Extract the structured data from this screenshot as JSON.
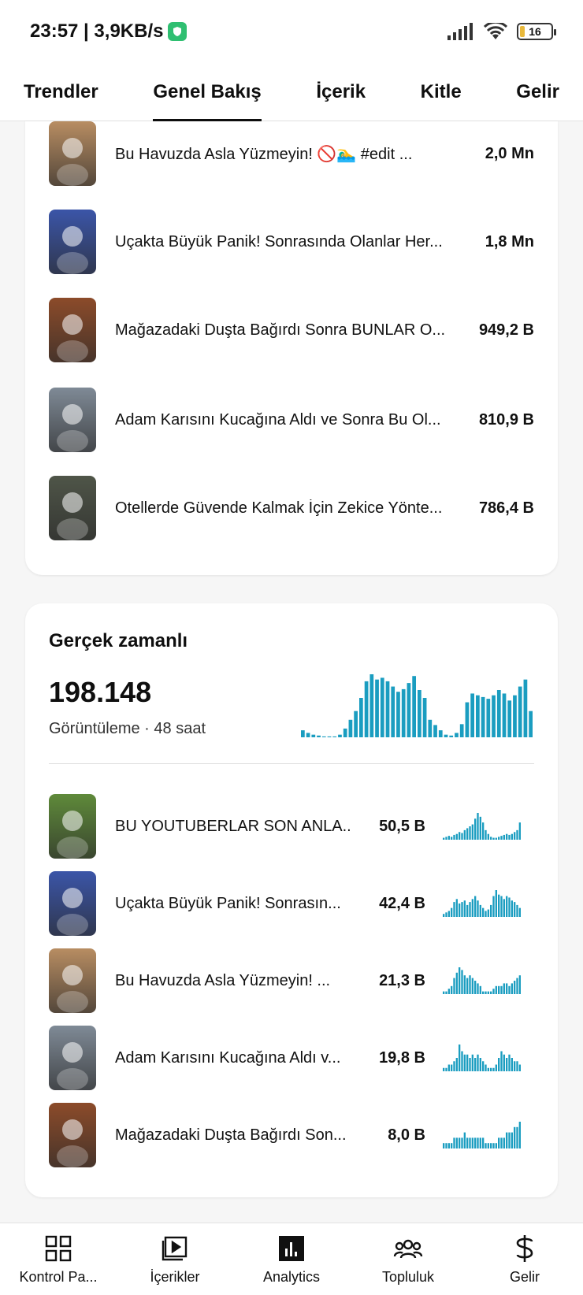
{
  "status_bar": {
    "time_speed": "23:57 | 3,9KB/s",
    "battery": "16"
  },
  "top_tabs": [
    {
      "label": "Trendler"
    },
    {
      "label": "Genel Bakış"
    },
    {
      "label": "İçerik"
    },
    {
      "label": "Kitle"
    },
    {
      "label": "Gelir"
    }
  ],
  "active_tab": "Genel Bakış",
  "top_list": {
    "items": [
      {
        "title": "Bu Havuzda Asla Yüzmeyin! 🚫🏊‍♂️ #edit ...",
        "value": "2,0 Mn",
        "thumb_color": "#b88d62"
      },
      {
        "title": "Uçakta Büyük Panik! Sonrasında Olanlar Her...",
        "value": "1,8 Mn",
        "thumb_color": "#3b55a8"
      },
      {
        "title": "Mağazadaki Duşta Bağırdı Sonra BUNLAR O...",
        "value": "949,2 B",
        "thumb_color": "#8c4b2a"
      },
      {
        "title": "Adam Karısını Kucağına Aldı ve Sonra Bu Ol...",
        "value": "810,9 B",
        "thumb_color": "#7f8a96"
      },
      {
        "title": "Otellerde Güvende Kalmak İçin Zekice Yönte...",
        "value": "786,4 B",
        "thumb_color": "#4f5548"
      }
    ]
  },
  "realtime": {
    "title": "Gerçek zamanlı",
    "total": "198.148",
    "subtitle": "Görüntüleme · 48 saat",
    "spark_color": "#1a9dc0",
    "spark": [
      8,
      5,
      3,
      2,
      1,
      1,
      1,
      3,
      10,
      20,
      30,
      45,
      64,
      72,
      66,
      68,
      64,
      58,
      52,
      55,
      62,
      70,
      54,
      45,
      20,
      14,
      8,
      3,
      2,
      5,
      15,
      40,
      50,
      48,
      46,
      44,
      48,
      54,
      50,
      42,
      48,
      58,
      66,
      30
    ],
    "items": [
      {
        "title": "BU YOUTUBERLAR SON ANLA...",
        "value": "50,5 B",
        "thumb_color": "#5f8a3a",
        "spark": [
          2,
          3,
          4,
          3,
          5,
          6,
          8,
          7,
          10,
          12,
          14,
          16,
          22,
          28,
          24,
          18,
          10,
          6,
          3,
          2,
          2,
          3,
          4,
          5,
          6,
          5,
          6,
          8,
          10,
          18
        ]
      },
      {
        "title": "Uçakta Büyük Panik! Sonrasın...",
        "value": "42,4 B",
        "thumb_color": "#3b55a8",
        "spark": [
          2,
          3,
          4,
          6,
          10,
          12,
          9,
          10,
          11,
          8,
          10,
          12,
          14,
          11,
          8,
          6,
          4,
          5,
          8,
          14,
          18,
          15,
          14,
          12,
          14,
          13,
          11,
          10,
          8,
          6
        ]
      },
      {
        "title": "Bu Havuzda Asla Yüzmeyin! ...",
        "value": "21,3 B",
        "thumb_color": "#b88d62",
        "spark": [
          1,
          1,
          2,
          3,
          6,
          8,
          10,
          9,
          7,
          6,
          7,
          6,
          5,
          4,
          3,
          1,
          1,
          1,
          1,
          2,
          3,
          3,
          3,
          4,
          4,
          3,
          4,
          5,
          6,
          7
        ]
      },
      {
        "title": "Adam Karısını Kucağına Aldı v...",
        "value": "19,8 B",
        "thumb_color": "#7f8a96",
        "spark": [
          1,
          1,
          2,
          2,
          3,
          4,
          8,
          6,
          5,
          5,
          4,
          5,
          4,
          5,
          4,
          3,
          2,
          1,
          1,
          1,
          2,
          4,
          6,
          5,
          4,
          5,
          4,
          3,
          3,
          2
        ]
      },
      {
        "title": "Mağazadaki Duşta Bağırdı Son...",
        "value": "8,0 B",
        "thumb_color": "#8c4b2a",
        "spark": [
          1,
          1,
          1,
          1,
          2,
          2,
          2,
          2,
          3,
          2,
          2,
          2,
          2,
          2,
          2,
          2,
          1,
          1,
          1,
          1,
          1,
          2,
          2,
          2,
          3,
          3,
          3,
          4,
          4,
          5
        ]
      }
    ]
  },
  "bottom_nav": [
    {
      "label": "Kontrol Pa...",
      "icon": "dashboard-icon"
    },
    {
      "label": "İçerikler",
      "icon": "content-icon"
    },
    {
      "label": "Analytics",
      "icon": "analytics-icon"
    },
    {
      "label": "Topluluk",
      "icon": "community-icon"
    },
    {
      "label": "Gelir",
      "icon": "dollar-icon"
    }
  ]
}
